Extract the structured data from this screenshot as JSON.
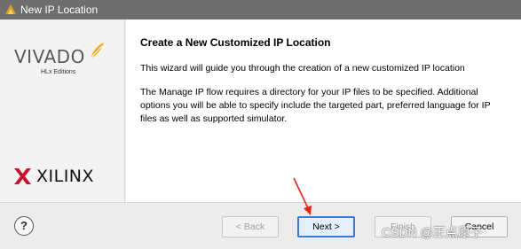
{
  "window": {
    "title": "New IP Location",
    "app_icon": "vivado-icon"
  },
  "sidebar": {
    "logo_vivado": {
      "word": "VIVADO",
      "edition": "HLx Editions"
    },
    "logo_xilinx": {
      "word": "XILINX",
      "mark": "."
    }
  },
  "content": {
    "heading": "Create a New Customized IP Location",
    "paragraph1": "This wizard will guide you through the creation of a new customized IP location",
    "paragraph2": "The Manage IP flow requires a directory for your IP files to be specified. Additional options you will be able to specify include the targeted part, preferred language for IP files as well as supported simulator."
  },
  "footer": {
    "help_label": "?",
    "back_label": "< Back",
    "next_label": "Next >",
    "finish_label": "Finish",
    "cancel_label": "Cancel",
    "watermark": "CSDN @正点原子"
  },
  "colors": {
    "titlebar": "#6e6e6e",
    "accent": "#3d79d6",
    "annotation_arrow": "#e8241c"
  }
}
